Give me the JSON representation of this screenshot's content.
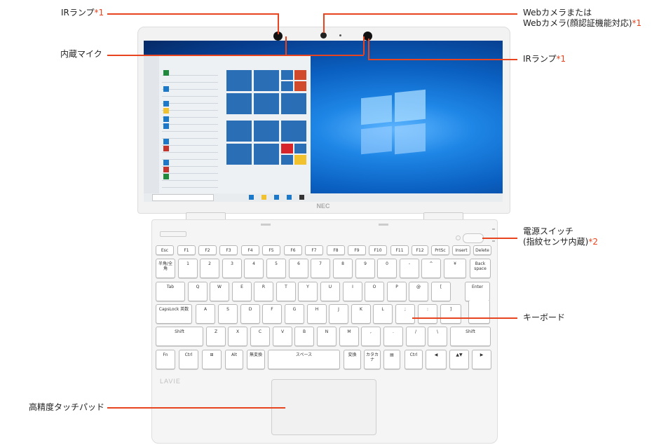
{
  "labels": {
    "ir_lamp_left": "IRランプ",
    "ir_lamp_left_mark": "*1",
    "builtin_mic": "内蔵マイク",
    "web_camera_line1": "Webカメラまたは",
    "web_camera_line2": "Webカメラ(顔認証機能対応)",
    "web_camera_mark": "*1",
    "ir_lamp_right": "IRランプ",
    "ir_lamp_right_mark": "*1",
    "power_switch_line1": "電源スイッチ",
    "power_switch_line2": "(指紋センサ内蔵)",
    "power_switch_mark": "*2",
    "keyboard": "キーボード",
    "touchpad": "高精度タッチパッド"
  },
  "branding": {
    "lid_logo": "NEC",
    "palm_logo": "LAVIE"
  },
  "keyboard": {
    "row1": [
      "Esc",
      "F1",
      "F2",
      "F3",
      "F4",
      "F5",
      "F6",
      "F7",
      "F8",
      "F9",
      "F10",
      "F11",
      "F12",
      "PrtSc",
      "Insert",
      "Delete"
    ],
    "row2": [
      "半角/全角",
      "1",
      "2",
      "3",
      "4",
      "5",
      "6",
      "7",
      "8",
      "9",
      "0",
      "-",
      "^",
      "¥",
      "Back space"
    ],
    "row3": [
      "Tab",
      "Q",
      "W",
      "E",
      "R",
      "T",
      "Y",
      "U",
      "I",
      "O",
      "P",
      "@",
      "[",
      "Enter"
    ],
    "row4": [
      "CapsLock 英数",
      "A",
      "S",
      "D",
      "F",
      "G",
      "H",
      "J",
      "K",
      "L",
      ";",
      ":",
      "]"
    ],
    "row5": [
      "Shift",
      "Z",
      "X",
      "C",
      "V",
      "B",
      "N",
      "M",
      ",",
      ".",
      "/",
      "\\",
      "Shift"
    ],
    "row6": [
      "Fn",
      "Ctrl",
      "⊞",
      "Alt",
      "無変換",
      "スペース",
      "変換",
      "カタカナ",
      "▤",
      "Ctrl",
      "◀",
      "▲▼",
      "▶"
    ]
  },
  "colors": {
    "accent": "#e8441f",
    "screen_blue": "#0a64c8",
    "tile_blue": "#2a6fb6"
  }
}
